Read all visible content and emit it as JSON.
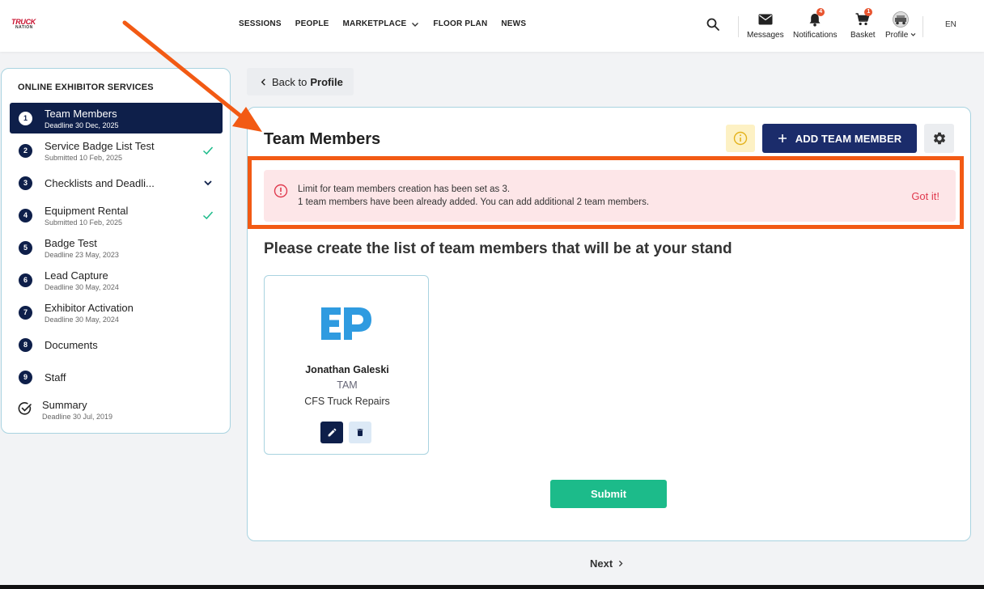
{
  "brand": {
    "logo_line1": "TRUCK",
    "logo_line2": "NATION"
  },
  "nav": {
    "sessions": "SESSIONS",
    "people": "PEOPLE",
    "marketplace": "MARKETPLACE",
    "floor_plan": "FLOOR PLAN",
    "news": "NEWS"
  },
  "utilities": {
    "messages": "Messages",
    "notifications": "Notifications",
    "notifications_count": "4",
    "basket": "Basket",
    "basket_count": "1",
    "profile": "Profile",
    "language": "EN"
  },
  "sidebar": {
    "title": "ONLINE EXHIBITOR SERVICES",
    "steps": [
      {
        "num": "1",
        "name": "Team Members",
        "sub": "Deadline 30 Dec, 2025"
      },
      {
        "num": "2",
        "name": "Service Badge List Test",
        "sub": "Submitted 10 Feb, 2025"
      },
      {
        "num": "3",
        "name": "Checklists and Deadli..."
      },
      {
        "num": "4",
        "name": "Equipment Rental",
        "sub": "Submitted 10 Feb, 2025"
      },
      {
        "num": "5",
        "name": "Badge Test",
        "sub": "Deadline 23 May, 2023"
      },
      {
        "num": "6",
        "name": "Lead Capture",
        "sub": "Deadline 30 May, 2024"
      },
      {
        "num": "7",
        "name": "Exhibitor Activation",
        "sub": "Deadline 30 May, 2024"
      },
      {
        "num": "8",
        "name": "Documents"
      },
      {
        "num": "9",
        "name": "Staff"
      },
      {
        "name": "Summary",
        "sub": "Deadline 30 Jul, 2019"
      }
    ]
  },
  "back": {
    "prefix": "Back to",
    "target": "Profile"
  },
  "main": {
    "title": "Team Members",
    "add_button": "ADD TEAM MEMBER",
    "alert": {
      "line1": "Limit for team members creation has been set as 3.",
      "line2": "1 team members have been already added. You can add additional 2 team members.",
      "dismiss": "Got it!"
    },
    "section_title": "Please create the list of team members that will be at your stand",
    "members": [
      {
        "name": "Jonathan Galeski",
        "role": "TAM",
        "company": "CFS Truck Repairs"
      }
    ],
    "submit": "Submit"
  },
  "next": "Next",
  "colors": {
    "navy": "#0e1f4a",
    "primary_button": "#1b2c6b",
    "success": "#1cbb8a",
    "alert_bg": "#fde6e8",
    "alert_text": "#e03a4e",
    "annotation": "#f25a14",
    "brand_blue": "#2f9be0"
  }
}
